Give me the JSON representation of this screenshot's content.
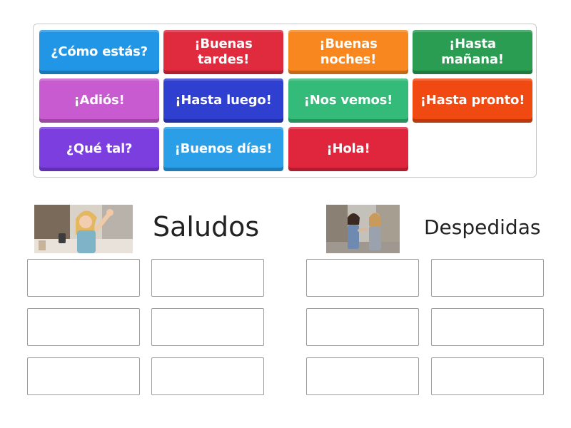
{
  "tiles": [
    {
      "label": "¿Cómo estás?",
      "color": "#2196e6"
    },
    {
      "label": "¡Buenas tardes!",
      "color": "#e02a3e"
    },
    {
      "label": "¡Buenas noches!",
      "color": "#f8871f"
    },
    {
      "label": "¡Hasta mañana!",
      "color": "#2a9d52"
    },
    {
      "label": "¡Adiós!",
      "color": "#c85bd0"
    },
    {
      "label": "¡Hasta luego!",
      "color": "#2f3fd0"
    },
    {
      "label": "¡Nos vemos!",
      "color": "#34ba79"
    },
    {
      "label": "¡Hasta pronto!",
      "color": "#f04a12"
    },
    {
      "label": "¿Qué tal?",
      "color": "#7d3ee0"
    },
    {
      "label": "¡Buenos días!",
      "color": "#2a9fe8"
    },
    {
      "label": "¡Hola!",
      "color": "#e0263d"
    }
  ],
  "groups": [
    {
      "title": "Saludos",
      "image": "woman-waving-photo"
    },
    {
      "title": "Despedidas",
      "image": "two-women-greeting-photo"
    }
  ]
}
